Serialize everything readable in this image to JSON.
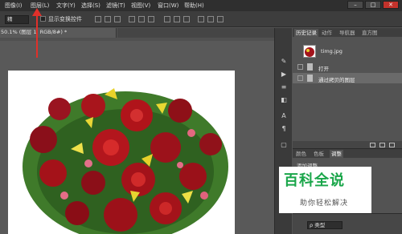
{
  "menubar": {
    "items": [
      "图像(I)",
      "图层(L)",
      "文字(Y)",
      "选择(S)",
      "滤镜(T)",
      "视图(V)",
      "窗口(W)",
      "帮助(H)"
    ],
    "window_buttons": [
      "–",
      "□",
      "✕"
    ]
  },
  "options_bar": {
    "select_value": "精",
    "show_transform_label": "显示变换控件"
  },
  "document": {
    "tab_title": "50.1% (图层 1, RGB/8#) *"
  },
  "history_panel": {
    "tabs": [
      "历史记录",
      "动作",
      "导航器",
      "直方图"
    ],
    "snapshot_label": "timg.jpg",
    "steps": [
      {
        "label": "打开",
        "selected": false
      },
      {
        "label": "通过拷贝的图层",
        "selected": true
      }
    ]
  },
  "adjust_panel": {
    "tabs": [
      "颜色",
      "色板",
      "调整"
    ],
    "title": "添加调整",
    "layers_kind_select": "ρ 类型"
  },
  "watermark": {
    "title": "百科全说",
    "subtitle": "助你轻松解决"
  },
  "colors": {
    "watermark_green": "#1aa64a",
    "annotation_red": "#e0302a"
  }
}
